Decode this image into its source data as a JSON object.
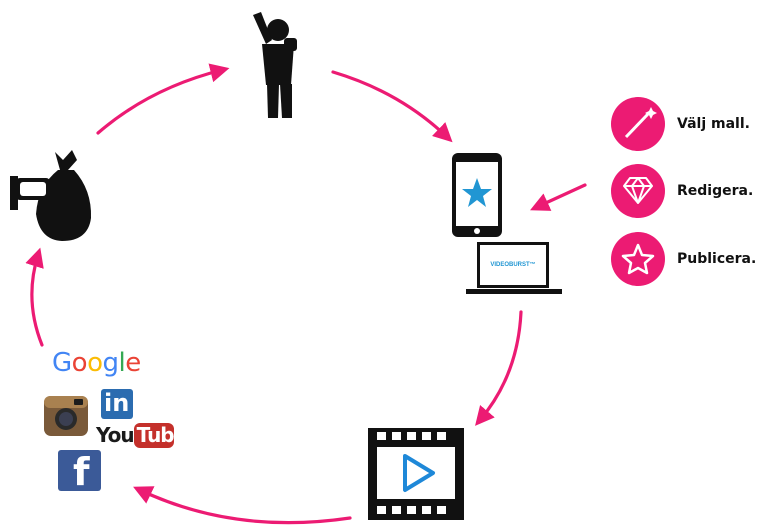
{
  "colors": {
    "accent": "#ec1b73",
    "icon_dark": "#111111",
    "play_blue": "#1e88d8",
    "star_blue": "#2196d3"
  },
  "steps": [
    {
      "label": "Välj mall.",
      "icon": "magic-wand-icon"
    },
    {
      "label": "Redigera.",
      "icon": "diamond-icon"
    },
    {
      "label": "Publicera.",
      "icon": "star-icon"
    }
  ],
  "laptop_screen_text": "VIDEOBURST™",
  "social": {
    "google": [
      "G",
      "o",
      "o",
      "g",
      "l",
      "e"
    ],
    "linkedin": "in",
    "youtube_you": "You",
    "youtube_tube": "Tube",
    "facebook": "f"
  }
}
